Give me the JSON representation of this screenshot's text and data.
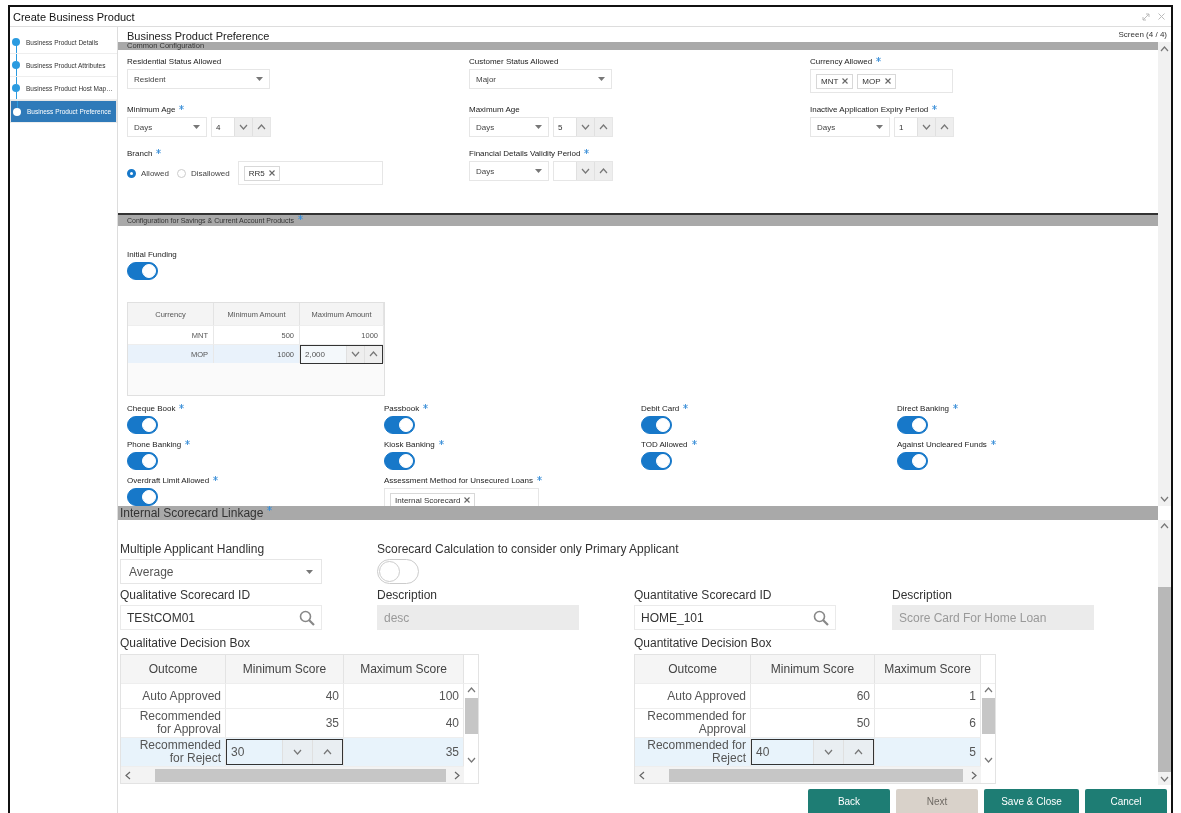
{
  "window": {
    "title": "Create Business Product"
  },
  "steps": [
    {
      "label": "Business Product Details",
      "selected": false
    },
    {
      "label": "Business Product Attributes",
      "selected": false
    },
    {
      "label": "Business Product Host Map…",
      "selected": false
    },
    {
      "label": "Business Product Preference",
      "selected": true
    }
  ],
  "page": {
    "title": "Business Product Preference",
    "screen": "Screen (4 / 4)"
  },
  "common": {
    "heading": "Common Configuration",
    "fields": [
      {
        "kind": "select",
        "label": "Residential Status Allowed",
        "required": false,
        "value": "Resident"
      },
      {
        "kind": "select",
        "label": "Customer Status Allowed",
        "required": false,
        "value": "Major"
      },
      {
        "kind": "tags",
        "label": "Currency Allowed",
        "required": true,
        "tags": [
          "MNT",
          "MOP"
        ]
      },
      {
        "kind": "period",
        "label": "Minimum Age",
        "required": true,
        "unit": "Days",
        "value": "4"
      },
      {
        "kind": "period",
        "label": "Maximum Age",
        "required": false,
        "unit": "Days",
        "value": "5"
      },
      {
        "kind": "period",
        "label": "Inactive Application Expiry Period",
        "required": true,
        "unit": "Days",
        "value": "1"
      },
      {
        "kind": "branch",
        "label": "Branch",
        "required": true,
        "options": [
          {
            "label": "Allowed",
            "selected": true
          },
          {
            "label": "Disallowed",
            "selected": false
          }
        ],
        "tags": [
          "RR5"
        ]
      },
      {
        "kind": "period",
        "label": "Financial Details Validity Period",
        "required": true,
        "unit": "Days"
      }
    ]
  },
  "savings": {
    "heading": "Configuration for Savings & Current Account Products",
    "required": true,
    "initial_funding": {
      "label": "Initial Funding",
      "on": true
    },
    "funding_table": {
      "columns": [
        "Currency",
        "Minimum Amount",
        "Maximum Amount"
      ],
      "rows": [
        {
          "selected": false,
          "cells": [
            "MNT",
            "500",
            "1000"
          ]
        },
        {
          "selected": true,
          "cells": [
            "MOP",
            "1000",
            {
              "kind": "spinner",
              "value": "2,000"
            }
          ]
        }
      ]
    },
    "features": [
      {
        "kind": "toggle",
        "label": "Cheque Book",
        "required": true,
        "on": true
      },
      {
        "kind": "toggle",
        "label": "Passbook",
        "required": true,
        "on": true
      },
      {
        "kind": "toggle",
        "label": "Debit Card",
        "required": true,
        "on": true
      },
      {
        "kind": "toggle",
        "label": "Direct Banking",
        "required": true,
        "on": true
      },
      {
        "kind": "toggle",
        "label": "Phone Banking",
        "required": true,
        "on": true
      },
      {
        "kind": "toggle",
        "label": "Kiosk Banking",
        "required": true,
        "on": true
      },
      {
        "kind": "toggle",
        "label": "TOD Allowed",
        "required": true,
        "on": true
      },
      {
        "kind": "toggle",
        "label": "Against Uncleared Funds",
        "required": true,
        "on": true
      },
      {
        "kind": "toggle",
        "label": "Overdraft Limit Allowed",
        "required": true,
        "on": true
      },
      {
        "kind": "tags",
        "label": "Assessment Method for Unsecured Loans",
        "required": true,
        "tags": [
          "Internal Scorecard"
        ]
      }
    ]
  },
  "scorecard": {
    "heading": "Internal Scorecard Linkage",
    "required": true,
    "applicant_handling": {
      "label": "Multiple Applicant Handling",
      "value": "Average"
    },
    "primary_only": {
      "label": "Scorecard Calculation to consider only Primary Applicant",
      "on": false
    },
    "lookups": [
      {
        "label": "Qualitative Scorecard ID",
        "value": "TEStCOM01",
        "description_label": "Description",
        "description": "desc",
        "description_disabled": true
      },
      {
        "label": "Quantitative Scorecard ID",
        "value": "HOME_101",
        "description_label": "Description",
        "description": "Score Card For Home Loan",
        "description_disabled": true
      }
    ],
    "tables": [
      {
        "title": "Qualitative Decision Box",
        "columns": [
          "Outcome",
          "Minimum Score",
          "Maximum Score"
        ],
        "rows": [
          {
            "selected": false,
            "cells": [
              "Auto Approved",
              "40",
              "100"
            ]
          },
          {
            "selected": false,
            "cells": [
              "Recommended for Approval",
              "35",
              "40"
            ]
          },
          {
            "selected": true,
            "cells": [
              "Recommended for Reject",
              {
                "kind": "spinner",
                "value": "30"
              },
              "35"
            ]
          }
        ]
      },
      {
        "title": "Quantitative Decision Box",
        "columns": [
          "Outcome",
          "Minimum Score",
          "Maximum Score"
        ],
        "rows": [
          {
            "selected": false,
            "cells": [
              "Auto Approved",
              "60",
              "1"
            ]
          },
          {
            "selected": false,
            "cells": [
              "Recommended for Approval",
              "50",
              "6"
            ]
          },
          {
            "selected": true,
            "cells": [
              "Recommended for Reject",
              {
                "kind": "spinner",
                "value": "40"
              },
              "5"
            ]
          }
        ]
      }
    ]
  },
  "buttons": [
    {
      "label": "Back",
      "disabled": false
    },
    {
      "label": "Next",
      "disabled": true
    },
    {
      "label": "Save & Close",
      "disabled": false
    },
    {
      "label": "Cancel",
      "disabled": false
    }
  ]
}
